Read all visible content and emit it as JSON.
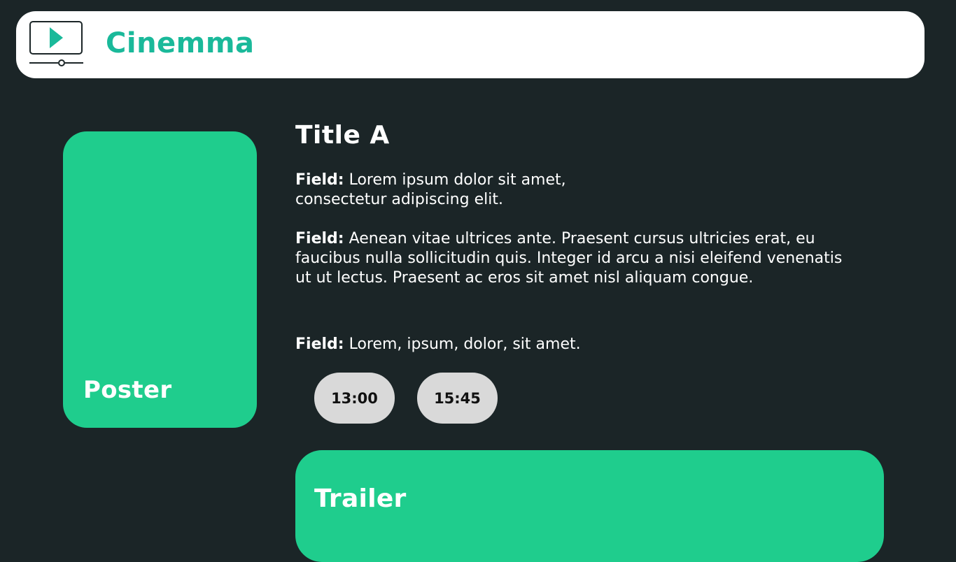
{
  "app": {
    "brand": "Cinemma",
    "icon": "play-monitor-icon",
    "accent_color": "#1ab99a"
  },
  "movie": {
    "title": "Title A",
    "poster_label": "Poster",
    "fields": [
      {
        "label": "Field:",
        "value": "Lorem ipsum dolor sit amet, consectetur adipiscing elit."
      },
      {
        "label": "Field:",
        "value": "Aenean vitae ultrices ante. Praesent cursus ultricies erat, eu faucibus nulla sollicitudin quis. Integer id arcu a nisi eleifend venenatis ut ut lectus. Praesent ac eros sit amet nisl aliquam congue."
      },
      {
        "label": "Field:",
        "value": "Lorem, ipsum, dolor, sit amet."
      }
    ],
    "showtimes": [
      "13:00",
      "15:45"
    ],
    "trailer_label": "Trailer"
  },
  "colors": {
    "background": "#1b2527",
    "card_green": "#1fcd8d",
    "showtime_bg": "#d9d9d9"
  }
}
